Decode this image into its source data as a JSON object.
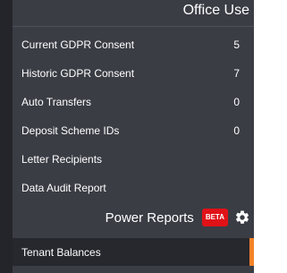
{
  "office_use": {
    "title": "Office Use",
    "items": [
      {
        "label": "Current GDPR Consent",
        "count": "5"
      },
      {
        "label": "Historic GDPR Consent",
        "count": "7"
      },
      {
        "label": "Auto Transfers",
        "count": "0"
      },
      {
        "label": "Deposit Scheme IDs",
        "count": "0"
      },
      {
        "label": "Letter Recipients",
        "count": ""
      },
      {
        "label": "Data Audit Report",
        "count": ""
      }
    ]
  },
  "power_reports": {
    "title": "Power Reports",
    "badge": "BETA",
    "badge_color": "#e01218",
    "settings_icon": "gear-icon",
    "items": [
      {
        "label": "Tenant Balances"
      }
    ]
  },
  "colors": {
    "panel": "#3b3d45",
    "active_item_bg": "#26282d",
    "accent": "#f5822a"
  }
}
